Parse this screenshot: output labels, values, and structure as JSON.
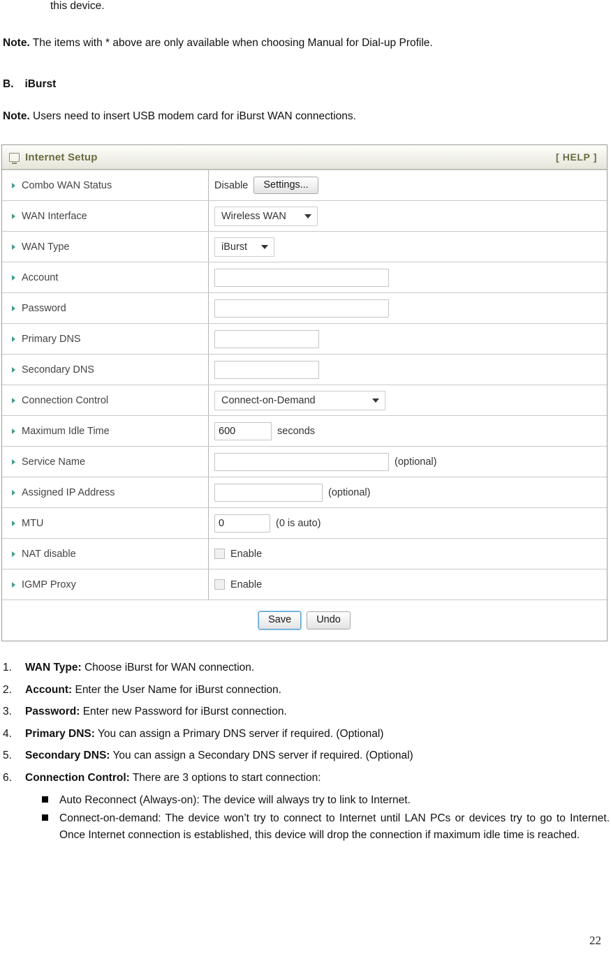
{
  "document": {
    "continued_line": "this device.",
    "note_1": {
      "bold": "Note.",
      "rest": " The items with * above are only available when choosing Manual for Dial-up Profile."
    },
    "section_heading": {
      "letter": "B.",
      "title": "iBurst"
    },
    "note_2": {
      "bold": "Note.",
      "rest": " Users need to insert USB modem card for iBurst WAN connections."
    },
    "page_number": "22"
  },
  "panel": {
    "title": "Internet Setup",
    "help_label": "[ HELP ]",
    "icon": "monitor-icon",
    "title_color": "#6b6b3f",
    "arrow_color": "#3f9e8c",
    "rows": [
      {
        "label": "Combo WAN Status",
        "type": "status-button",
        "status": "Disable",
        "button": "Settings..."
      },
      {
        "label": "WAN Interface",
        "type": "select",
        "value": "Wireless WAN"
      },
      {
        "label": "WAN Type",
        "type": "select",
        "value": "iBurst"
      },
      {
        "label": "Account",
        "type": "text",
        "value": "",
        "placeholder": ""
      },
      {
        "label": "Password",
        "type": "text",
        "value": "",
        "placeholder": ""
      },
      {
        "label": "Primary DNS",
        "type": "text",
        "value": "",
        "placeholder": ""
      },
      {
        "label": "Secondary DNS",
        "type": "text",
        "value": "",
        "placeholder": ""
      },
      {
        "label": "Connection Control",
        "type": "select",
        "value": "Connect-on-Demand"
      },
      {
        "label": "Maximum Idle Time",
        "type": "text-suffix",
        "value": "600",
        "suffix": "seconds"
      },
      {
        "label": "Service Name",
        "type": "text-suffix",
        "value": "",
        "suffix": "(optional)"
      },
      {
        "label": "Assigned IP Address",
        "type": "text-suffix",
        "value": "",
        "suffix": "(optional)"
      },
      {
        "label": "MTU",
        "type": "text-suffix",
        "value": "0",
        "suffix": "(0 is auto)"
      },
      {
        "label": "NAT disable",
        "type": "checkbox",
        "checkbox_label": "Enable",
        "checked": false
      },
      {
        "label": "IGMP Proxy",
        "type": "checkbox",
        "checkbox_label": "Enable",
        "checked": false
      }
    ],
    "footer": {
      "save_label": "Save",
      "undo_label": "Undo",
      "save_focused": true
    }
  },
  "instructions": {
    "items": [
      {
        "num": "1.",
        "term": "WAN Type:",
        "text": " Choose iBurst for WAN connection."
      },
      {
        "num": "2.",
        "term": "Account:",
        "text": " Enter the User Name for iBurst connection."
      },
      {
        "num": "3.",
        "term": "Password:",
        "text": " Enter new Password for iBurst connection."
      },
      {
        "num": "4.",
        "term": "Primary DNS:",
        "text": " You can assign a Primary DNS server if required. (Optional)"
      },
      {
        "num": "5.",
        "term": "Secondary DNS:",
        "text": " You can assign a Secondary DNS server if required. (Optional)"
      },
      {
        "num": "6.",
        "term": "Connection Control:",
        "text": " There are 3 options to start connection:"
      }
    ],
    "bullets": [
      "Auto Reconnect (Always-on): The device will always try to link to Internet.",
      "Connect-on-demand: The device won’t try to connect to Internet until LAN PCs or devices try to go to Internet. Once Internet connection is established, this device will drop the connection if maximum idle time is reached."
    ]
  }
}
